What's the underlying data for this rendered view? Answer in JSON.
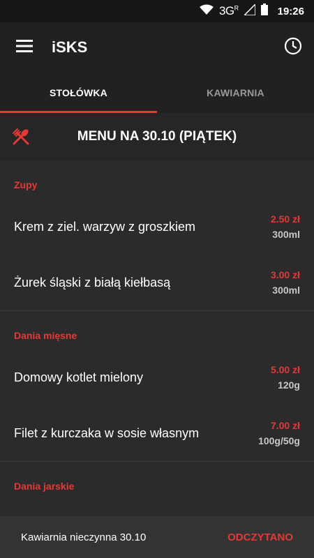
{
  "status_bar": {
    "network": "3G",
    "network_sup": "R",
    "time": "19:26"
  },
  "app_bar": {
    "menu_icon": "hamburger-menu-icon",
    "title": "iSKS",
    "history_icon": "clock-icon"
  },
  "tabs": [
    {
      "label": "STOŁÓWKA",
      "active": true
    },
    {
      "label": "KAWIARNIA",
      "active": false
    }
  ],
  "menu_header": {
    "icon": "cutlery-icon",
    "title": "MENU NA 30.10 (PIĄTEK)"
  },
  "sections": [
    {
      "title": "Zupy",
      "items": [
        {
          "name": "Krem z ziel. warzyw z groszkiem",
          "price": "2.50 zł",
          "qty": "300ml"
        },
        {
          "name": "Żurek śląski z białą kiełbasą",
          "price": "3.00 zł",
          "qty": "300ml"
        }
      ]
    },
    {
      "title": "Dania mięsne",
      "items": [
        {
          "name": "Domowy kotlet mielony",
          "price": "5.00 zł",
          "qty": "120g"
        },
        {
          "name": "Filet z kurczaka w sosie własnym",
          "price": "7.00 zł",
          "qty": "100g/50g"
        }
      ]
    },
    {
      "title": "Dania jarskie",
      "items": []
    }
  ],
  "snackbar": {
    "message": "Kawiarnia nieczynna 30.10",
    "action": "ODCZYTANO"
  },
  "colors": {
    "accent": "#e53935",
    "background": "#2b2b2b",
    "app_bar": "#212121"
  }
}
